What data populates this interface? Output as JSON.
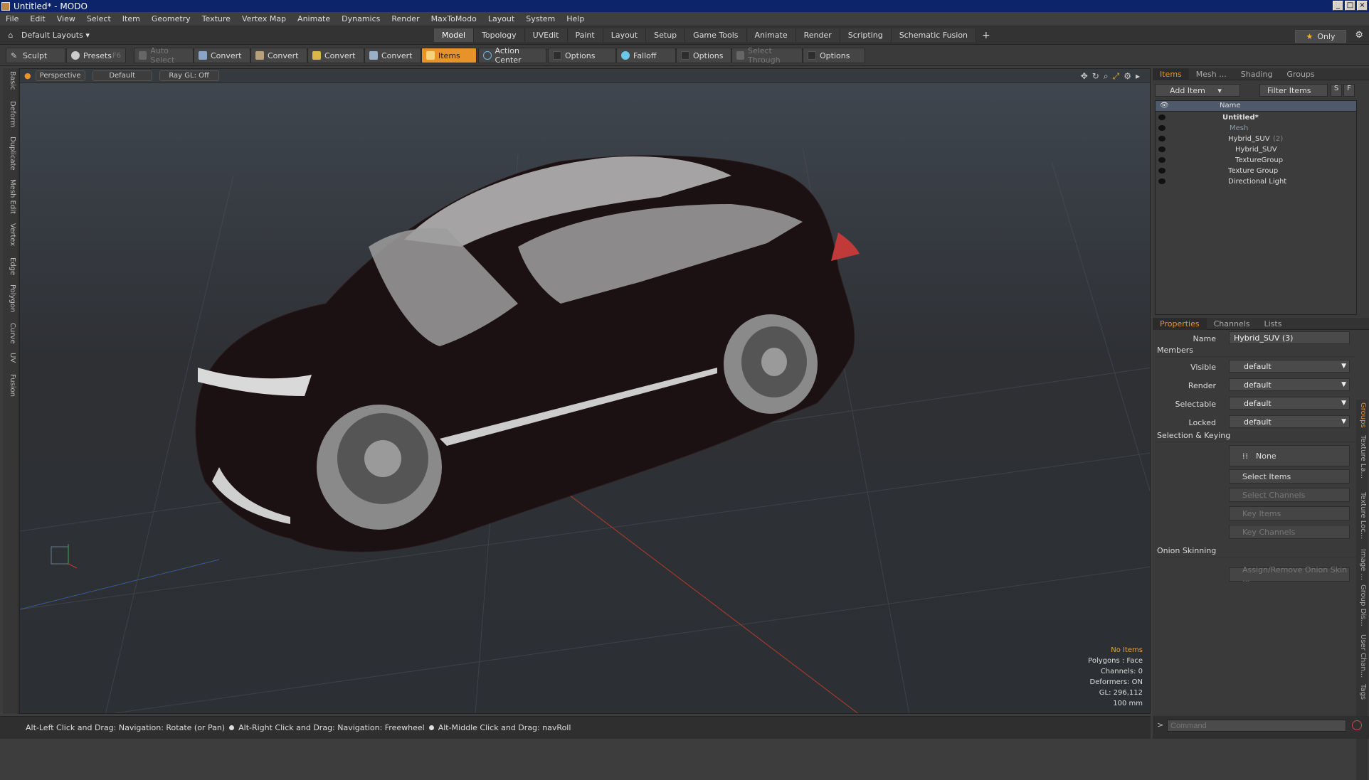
{
  "window": {
    "title": "Untitled* - MODO"
  },
  "menu": [
    "File",
    "Edit",
    "View",
    "Select",
    "Item",
    "Geometry",
    "Texture",
    "Vertex Map",
    "Animate",
    "Dynamics",
    "Render",
    "MaxToModo",
    "Layout",
    "System",
    "Help"
  ],
  "layout": {
    "default_label": "Default Layouts",
    "tabs": [
      "Model",
      "Topology",
      "UVEdit",
      "Paint",
      "Layout",
      "Setup",
      "Game Tools",
      "Animate",
      "Render",
      "Scripting",
      "Schematic Fusion"
    ],
    "active_tab": "Model",
    "only_label": "Only"
  },
  "toolbar": {
    "sculpt": "Sculpt",
    "presets": "Presets",
    "presets_key": "F6",
    "auto_select": "Auto Select",
    "convert1": "Convert",
    "convert2": "Convert",
    "convert3": "Convert",
    "convert4": "Convert",
    "items": "Items",
    "action_center": "Action Center",
    "options1": "Options",
    "falloff": "Falloff",
    "options2": "Options",
    "select_through": "Select Through",
    "options3": "Options"
  },
  "left_tabs": [
    "Basic",
    "Deform",
    "Duplicate",
    "Mesh Edit",
    "Vertex",
    "Edge",
    "Polygon",
    "Curve",
    "UV",
    "Fusion"
  ],
  "viewport": {
    "view": "Perspective",
    "shading": "Default",
    "raygl": "Ray GL: Off",
    "stats": {
      "items": "No Items",
      "polygons": "Polygons : Face",
      "channels": "Channels: 0",
      "deformers": "Deformers: ON",
      "gl": "GL: 296,112",
      "scale": "100 mm"
    }
  },
  "status": {
    "hint1": "Alt-Left Click and Drag: Navigation: Rotate (or Pan)",
    "hint2": "Alt-Right Click and Drag: Navigation: Freewheel",
    "hint3": "Alt-Middle Click and Drag: navRoll"
  },
  "items_panel": {
    "tabs": [
      "Items",
      "Mesh ...",
      "Shading",
      "Groups"
    ],
    "add_item": "Add Item",
    "filter_items": "Filter Items",
    "s_btn": "S",
    "f_btn": "F",
    "name_header": "Name",
    "tree": [
      {
        "label": "Untitled*"
      },
      {
        "label": "Mesh"
      },
      {
        "label": "Hybrid_SUV",
        "count": "(2)"
      },
      {
        "label": "Hybrid_SUV"
      },
      {
        "label": "TextureGroup"
      },
      {
        "label": "Texture Group"
      },
      {
        "label": "Directional Light"
      }
    ]
  },
  "properties": {
    "tabs": [
      "Properties",
      "Channels",
      "Lists"
    ],
    "name_label": "Name",
    "name_value": "Hybrid_SUV (3)",
    "members_section": "Members",
    "visible_label": "Visible",
    "visible_value": "default",
    "render_label": "Render",
    "render_value": "default",
    "selectable_label": "Selectable",
    "selectable_value": "default",
    "locked_label": "Locked",
    "locked_value": "default",
    "sel_keying_section": "Selection & Keying",
    "none_label": "None",
    "select_items": "Select Items",
    "select_channels": "Select Channels",
    "key_items": "Key Items",
    "key_channels": "Key Channels",
    "onion_section": "Onion Skinning",
    "assign_onion": "Assign/Remove Onion Skin ..."
  },
  "right_tabs": [
    "Groups",
    "Texture La...",
    "Texture Loc...",
    "Image ...",
    "Group Dis...",
    "User Chan...",
    "Tags"
  ],
  "command": {
    "placeholder": "Command"
  }
}
